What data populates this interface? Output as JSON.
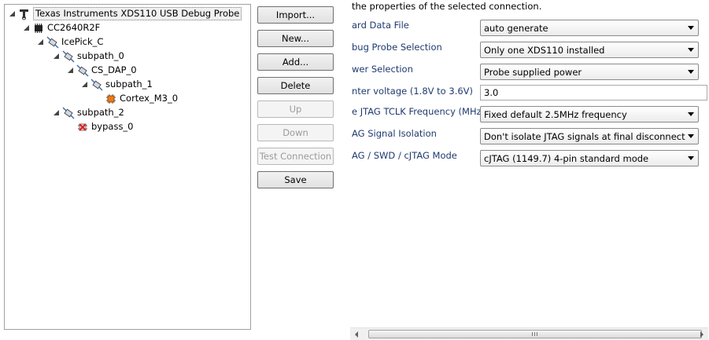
{
  "tree": [
    {
      "label": "Texas Instruments XDS110 USB Debug Probe",
      "icon": "probe-icon",
      "expanded": true,
      "selected": true
    },
    {
      "label": "CC2640R2F",
      "icon": "chip-icon",
      "expanded": true
    },
    {
      "label": "IcePick_C",
      "icon": "router-icon",
      "expanded": true
    },
    {
      "label": "subpath_0",
      "icon": "router-icon",
      "expanded": true
    },
    {
      "label": "CS_DAP_0",
      "icon": "router-icon",
      "expanded": true
    },
    {
      "label": "subpath_1",
      "icon": "router-icon",
      "expanded": true
    },
    {
      "label": "Cortex_M3_0",
      "icon": "cpu-icon",
      "expanded": false
    },
    {
      "label": "subpath_2",
      "icon": "router-icon",
      "expanded": true
    },
    {
      "label": "bypass_0",
      "icon": "bypass-icon",
      "expanded": false
    }
  ],
  "buttons": {
    "import": "Import...",
    "new": "New...",
    "add": "Add...",
    "delete": "Delete",
    "up": "Up",
    "down": "Down",
    "test": "Test Connection",
    "save": "Save"
  },
  "properties": {
    "header": "the properties of the selected connection.",
    "rows": [
      {
        "label": "ard Data File",
        "value": "auto generate",
        "type": "combo"
      },
      {
        "label": "bug Probe Selection",
        "value": "Only one XDS110 installed",
        "type": "combo"
      },
      {
        "label": "wer Selection",
        "value": "Probe supplied power",
        "type": "combo"
      },
      {
        "label": "nter voltage (1.8V to 3.6V)",
        "value": "3.0",
        "type": "text"
      },
      {
        "label": "e JTAG TCLK Frequency (MHz)",
        "value": "Fixed default 2.5MHz frequency",
        "type": "combo"
      },
      {
        "label": "AG Signal Isolation",
        "value": "Don't isolate JTAG signals at final disconnect",
        "type": "combo"
      },
      {
        "label": "AG / SWD / cJTAG Mode",
        "value": "cJTAG (1149.7) 4-pin standard mode",
        "type": "combo"
      }
    ]
  },
  "colors": {
    "label_blue": "#1f3a6e",
    "cpu_orange": "#e87a1d",
    "bypass_red": "#d92020"
  }
}
